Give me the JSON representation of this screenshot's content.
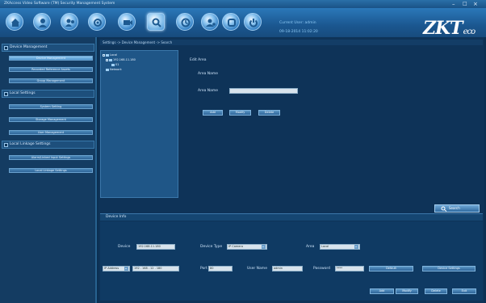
{
  "window": {
    "title": "ZKAccess Video Software (TM) Security Management System"
  },
  "toolbar": {
    "buttons": [
      {
        "icon": "home-icon"
      },
      {
        "icon": "user-icon"
      },
      {
        "icon": "personnel-group-icon"
      },
      {
        "icon": "device-settings-icon"
      },
      {
        "icon": "camera-icon"
      },
      {
        "icon": "search-device-icon"
      },
      {
        "icon": "report-icon"
      },
      {
        "icon": "user-settings-icon"
      },
      {
        "icon": "system-icon"
      },
      {
        "icon": "power-icon"
      }
    ],
    "current_user": "Current User: admin",
    "current_time": "09-18-2014 11:02:20"
  },
  "brand": {
    "logo": "ZKT",
    "logo_suffix": "eco"
  },
  "sidebar": {
    "sections": [
      {
        "label": "Device Management",
        "items": [
          "Device Management",
          "Recorded Reference Assets",
          "Group Management"
        ]
      },
      {
        "label": "Local Settings",
        "items": [
          "System Setting",
          "Storage Management",
          "User Management"
        ]
      },
      {
        "label": "Local Linkage Settings",
        "items": [
          "Alarm/Linked Input Settings",
          "Local Linkage Settings"
        ]
      }
    ]
  },
  "main": {
    "breadcrumb": "Settings -> Device Management -> Search",
    "tree": [
      "Local",
      "192.168.11.180",
      "01",
      "Network"
    ],
    "edit_area": {
      "title": "Edit Area",
      "area_name_label": "Area Name",
      "area_name2_label": "Area Name",
      "area_name_value": "",
      "buttons": [
        "Add",
        "Modify",
        "Delete"
      ]
    },
    "search_button": "Search",
    "device_info": {
      "title": "Device Info",
      "device_label": "Device",
      "device_value": "192.168.11.180",
      "device_type_label": "Device Type",
      "device_type_value": "IP Camera",
      "area_label": "Area",
      "area_value": "Local",
      "ip_mode_value": "IP Address",
      "ip_value": "192 . 168 . 12 . 180",
      "port_label": "Port",
      "port_value": "80",
      "user_name_label": "User Name",
      "user_name_value": "admin",
      "password_label": "Password",
      "password_value": "****",
      "action_buttons": [
        "Default",
        "Device Settings"
      ],
      "bottom_buttons": [
        "Add",
        "Modify",
        "Delete",
        "Exit"
      ]
    }
  },
  "colors": {
    "background": "#0b2f52",
    "toolbar": "#1b5790",
    "accent": "#4f95cd"
  }
}
